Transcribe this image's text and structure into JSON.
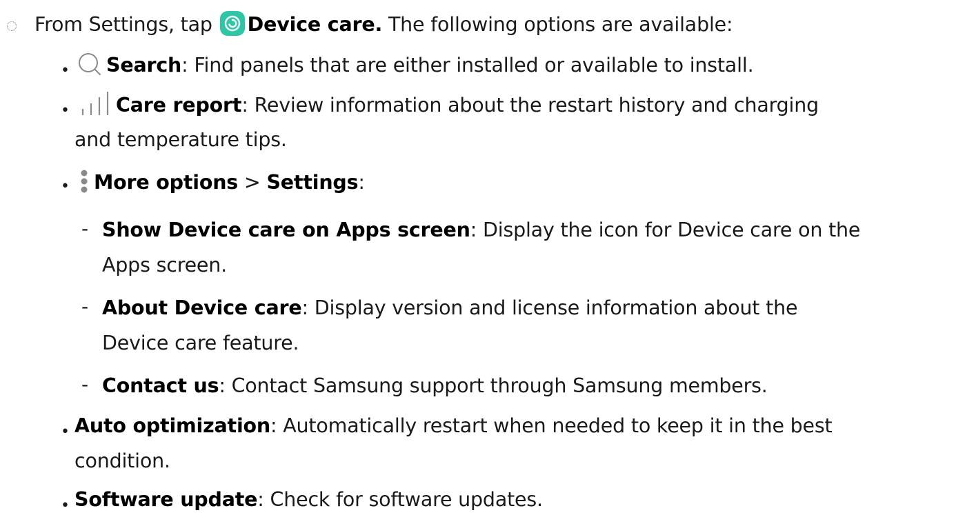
{
  "intro": {
    "prefix": "From Settings, tap",
    "app_name": "Device care.",
    "suffix": "The following options are available:",
    "app_icon": "device-care-icon"
  },
  "options": [
    {
      "icon": "search-icon",
      "title": "Search",
      "text": ": Find panels that are either installed or available to install."
    },
    {
      "icon": "bar-chart-icon",
      "title": "Care report",
      "text": ": Review information about the restart history and charging",
      "text_cont": "and temperature tips."
    },
    {
      "icon": "more-options-icon",
      "title": "More options",
      "separator": " > ",
      "title2": "Settings",
      "colon": ":"
    }
  ],
  "settings": [
    {
      "title": "Show Device care on Apps screen",
      "text": ": Display the icon for Device care on the",
      "text_cont": "Apps screen."
    },
    {
      "title": "About Device care",
      "text": ": Display version and license information about the",
      "text_cont": "Device care feature."
    },
    {
      "title": "Contact us",
      "text": ": Contact Samsung support through Samsung members."
    }
  ],
  "extra": [
    {
      "title": "Auto optimization",
      "text": ": Automatically restart when needed to keep it in the best",
      "text_cont": "condition."
    },
    {
      "title": "Software update",
      "text": ": Check for software updates."
    }
  ],
  "colors": {
    "app_icon_bg": "#2fc6a8",
    "text": "#1a1a1a",
    "icon_gray": "#8a8a8a"
  }
}
